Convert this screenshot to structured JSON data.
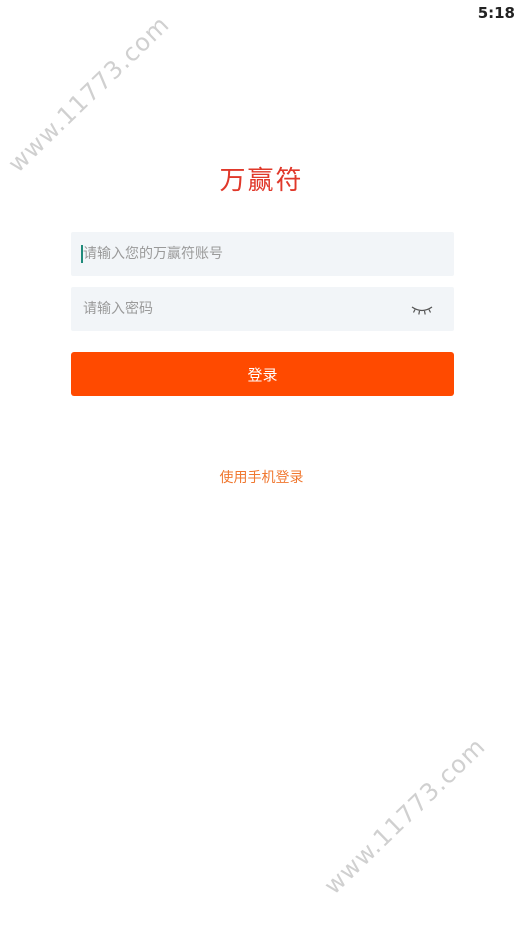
{
  "status_bar": {
    "time": "5:18"
  },
  "watermarks": [
    "www.11773.com",
    "www.11773.com"
  ],
  "logo": {
    "text": "万赢符"
  },
  "login_form": {
    "account_placeholder": "请输入您的万赢符账号",
    "account_value": "",
    "password_placeholder": "请输入密码",
    "password_value": "",
    "password_toggle_icon": "eye-closed-icon",
    "login_button_label": "登录"
  },
  "alt_login": {
    "phone_login_label": "使用手机登录"
  },
  "colors": {
    "logo": "#e0382a",
    "primary_button": "#ff4a00",
    "link": "#f07830",
    "input_bg": "#f2f5f8",
    "caret": "#1f8a7a"
  }
}
